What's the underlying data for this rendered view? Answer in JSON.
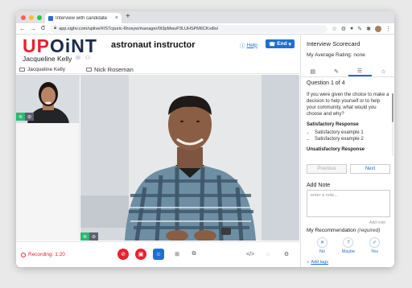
{
  "browser": {
    "tab_title": "Interview with candidate",
    "tab_close": "×",
    "new_tab": "+",
    "url": "app.sighv.com/uplive/#/S7cpuric-6hosyw/manager/0t3pMwuP3LUHSPM6CKvdlo/",
    "nav": {
      "back": "←",
      "forward": "→",
      "reload": "C"
    },
    "traffic_colors": [
      "#ff5f57",
      "#febc2e",
      "#28c840"
    ]
  },
  "header": {
    "logo_left": "UP",
    "logo_right": "OiNT",
    "job_title": "astronaut instructor",
    "candidate_name": "Jacqueline Kelly",
    "help_label": "Help",
    "end_label": "End",
    "brand_red": "#e8212f",
    "brand_blue": "#1f6fd1"
  },
  "participants": {
    "thumb_label": "Jacqueline Kelly",
    "main_label": "Nick Roseman"
  },
  "toolbar": {
    "recording": "Recording: 1:20"
  },
  "scorecard": {
    "title": "Interview Scorecard",
    "avg_rating": "My Average Rating: none",
    "question_number": "Question 1 of 4",
    "question_text": "If you were given the choice to make a decision to help yourself or to help your community, what would you choose and why?",
    "satisfactory_heading": "Satisfactory Response",
    "satisfactory_examples": [
      "Satisfactory example 1",
      "Satisfactory example 2"
    ],
    "unsatisfactory_heading": "Unsatisfactory Response",
    "previous_label": "Previous",
    "next_label": "Next",
    "add_note_heading": "Add Note",
    "note_placeholder": "enter a note...",
    "add_note_button": "Add note",
    "recommendation_heading": "My Recommendation",
    "recommendation_required": "(required)",
    "rec_no": "No",
    "rec_maybe": "Maybe",
    "rec_yes": "Yes",
    "add_tags": "Add tags"
  }
}
